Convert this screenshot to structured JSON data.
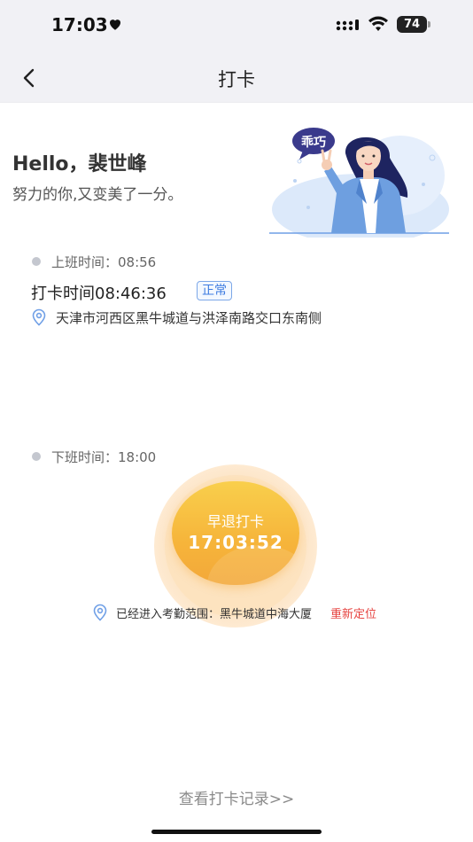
{
  "status_bar": {
    "time": "17:03",
    "battery": "74"
  },
  "nav": {
    "title": "打卡"
  },
  "header": {
    "greeting": "Hello，裴世峰",
    "subtitle": "努力的你,又变美了一分。",
    "illustration_bubble": "乖巧"
  },
  "clock_in": {
    "label": "上班时间：08:56",
    "record": "打卡时间08:46:36",
    "status": "正常",
    "address": "天津市河西区黑牛城道与洪泽南路交口东南侧"
  },
  "clock_out": {
    "label": "下班时间：18:00",
    "button_label": "早退打卡",
    "current_time": "17:03:52",
    "range_text": "已经进入考勤范围：黑牛城道中海大厦",
    "relocate_label": "重新定位"
  },
  "footer": {
    "records_link": "查看打卡记录>>"
  },
  "colors": {
    "accent_blue": "#3d7be0",
    "button_orange": "#f6b43a",
    "warning_red": "#e64340"
  }
}
